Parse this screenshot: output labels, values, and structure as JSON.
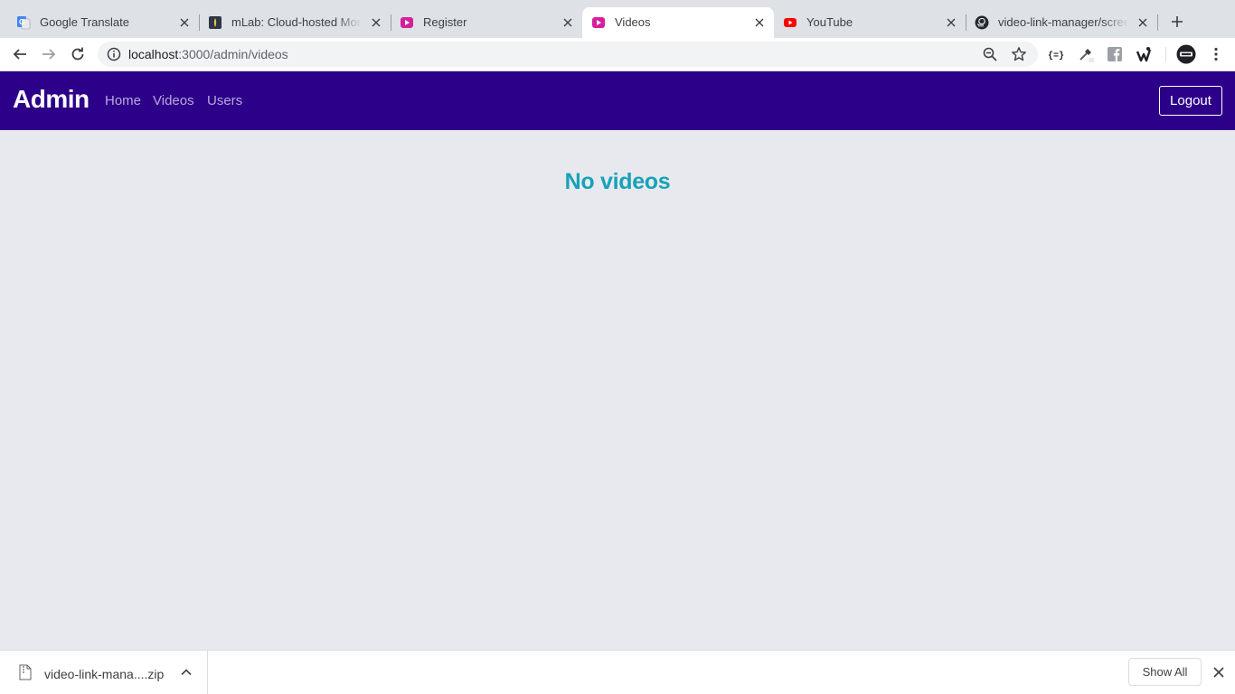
{
  "browser": {
    "tabs": [
      {
        "title": "Google Translate",
        "icon": "google-translate-icon"
      },
      {
        "title": "mLab: Cloud-hosted MongoDB",
        "icon": "mlab-icon"
      },
      {
        "title": "Register",
        "icon": "video-app-icon"
      },
      {
        "title": "Videos",
        "icon": "video-app-icon",
        "active": true
      },
      {
        "title": "YouTube",
        "icon": "youtube-icon"
      },
      {
        "title": "video-link-manager/screenshots",
        "icon": "github-icon"
      }
    ],
    "url_host": "localhost",
    "url_path": ":3000/admin/videos"
  },
  "navbar": {
    "brand": "Admin",
    "links": [
      "Home",
      "Videos",
      "Users"
    ],
    "logout_label": "Logout",
    "background": "#2d0089"
  },
  "main": {
    "empty_message": "No videos",
    "message_color": "#17a2b8"
  },
  "downloads": {
    "file_name": "video-link-mana....zip",
    "show_all_label": "Show All"
  }
}
